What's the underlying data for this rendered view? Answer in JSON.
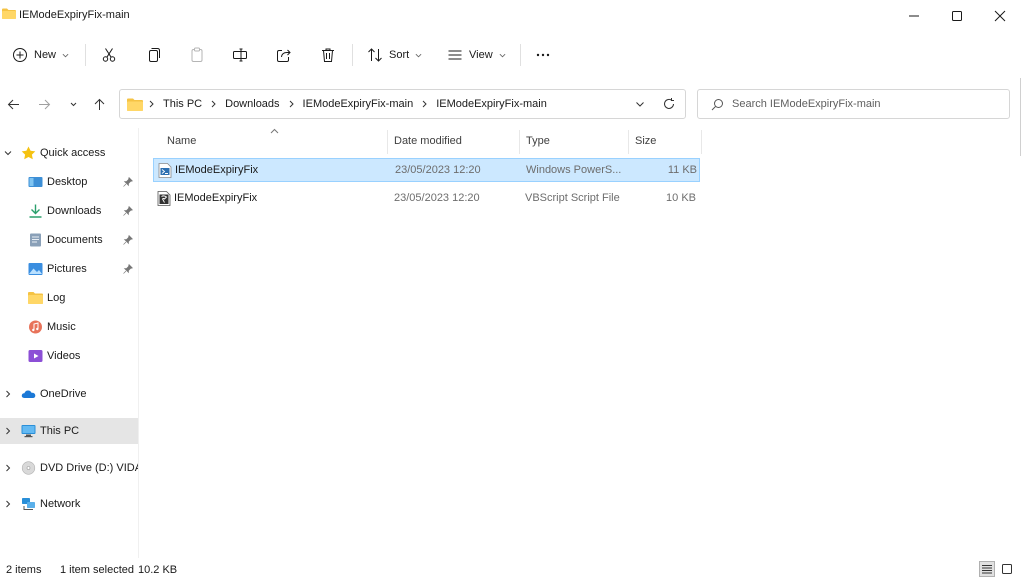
{
  "window": {
    "title": "IEModeExpiryFix-main",
    "controls": [
      "minimize",
      "maximize",
      "close"
    ]
  },
  "toolbar": {
    "new_label": "New",
    "sort_label": "Sort",
    "view_label": "View",
    "icons": [
      "cut-icon",
      "copy-icon",
      "paste-icon",
      "rename-icon",
      "share-icon",
      "delete-icon",
      "more-icon"
    ]
  },
  "address": {
    "crumbs": [
      "This PC",
      "Downloads",
      "IEModeExpiryFix-main",
      "IEModeExpiryFix-main"
    ]
  },
  "search": {
    "placeholder": "Search IEModeExpiryFix-main"
  },
  "sidebar": {
    "quick_access": "Quick access",
    "items": [
      {
        "label": "Desktop",
        "pinned": true
      },
      {
        "label": "Downloads",
        "pinned": true
      },
      {
        "label": "Documents",
        "pinned": true
      },
      {
        "label": "Pictures",
        "pinned": true
      },
      {
        "label": "Log",
        "pinned": false
      },
      {
        "label": "Music",
        "pinned": false
      },
      {
        "label": "Videos",
        "pinned": false
      }
    ],
    "onedrive": "OneDrive",
    "this_pc": "This PC",
    "dvd": "DVD Drive (D:) VIDA",
    "network": "Network"
  },
  "columns": {
    "name": "Name",
    "date": "Date modified",
    "type": "Type",
    "size": "Size"
  },
  "files": [
    {
      "name": "IEModeExpiryFix",
      "date": "23/05/2023 12:20",
      "type": "Windows PowerS...",
      "size": "11 KB",
      "selected": true
    },
    {
      "name": "IEModeExpiryFix",
      "date": "23/05/2023 12:20",
      "type": "VBScript Script File",
      "size": "10 KB",
      "selected": false
    }
  ],
  "status": {
    "items": "2 items",
    "selection": "1 item selected",
    "size": "10.2 KB"
  },
  "colors": {
    "selected_row": "#cce8ff",
    "selected_border": "#99d1ff",
    "folder": "#f5c344",
    "selected_nav": "#e5e5e5"
  }
}
